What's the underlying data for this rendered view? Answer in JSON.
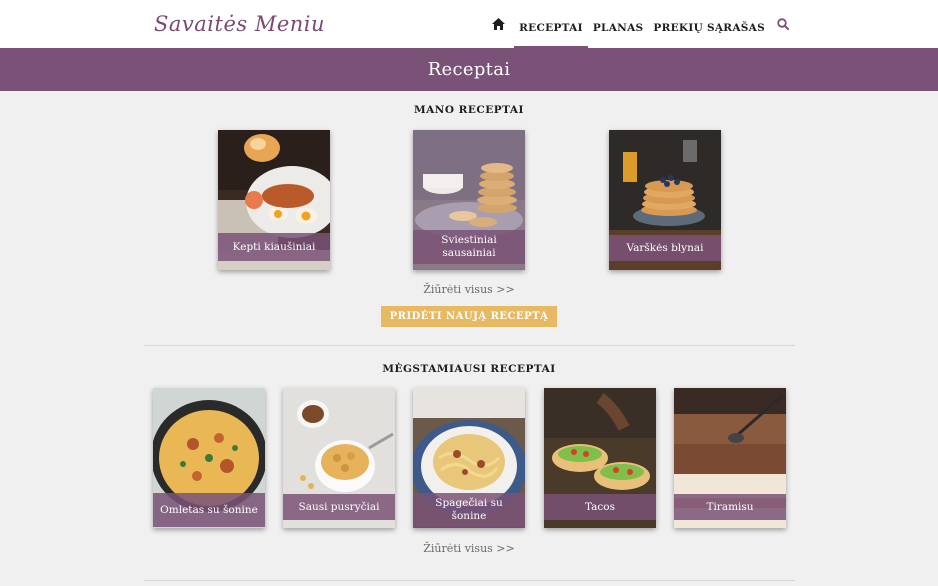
{
  "header": {
    "logo": "Savaitės Meniu",
    "nav": [
      "RECEPTAI",
      "PLANAS",
      "PREKIŲ SĄRAŠAS"
    ],
    "active_nav": "RECEPTAI",
    "home_icon": "home-icon",
    "search_icon": "search-icon"
  },
  "banner": {
    "title": "Receptai"
  },
  "my_recipes": {
    "title": "MANO RECEPTAI",
    "items": [
      {
        "label": "Kepti kiaušiniai"
      },
      {
        "label": "Sviestiniai sausainiai"
      },
      {
        "label": "Varškės blynai"
      }
    ],
    "see_all": "Žiūrėti visus >>",
    "add_button": "PRIDĖTI NAUJĄ RECEPTĄ"
  },
  "favorite_recipes": {
    "title": "MĖGSTAMIAUSI RECEPTAI",
    "items": [
      {
        "label": "Omletas su šonine"
      },
      {
        "label": "Sausi pusryčiai"
      },
      {
        "label": "Spagečiai su šonine"
      },
      {
        "label": "Tacos"
      },
      {
        "label": "Tiramisu"
      }
    ],
    "see_all": "Žiūrėti visus >>"
  },
  "colors": {
    "accent": "#7a5277",
    "button": "#e8b963",
    "background": "#f1f0f0"
  }
}
